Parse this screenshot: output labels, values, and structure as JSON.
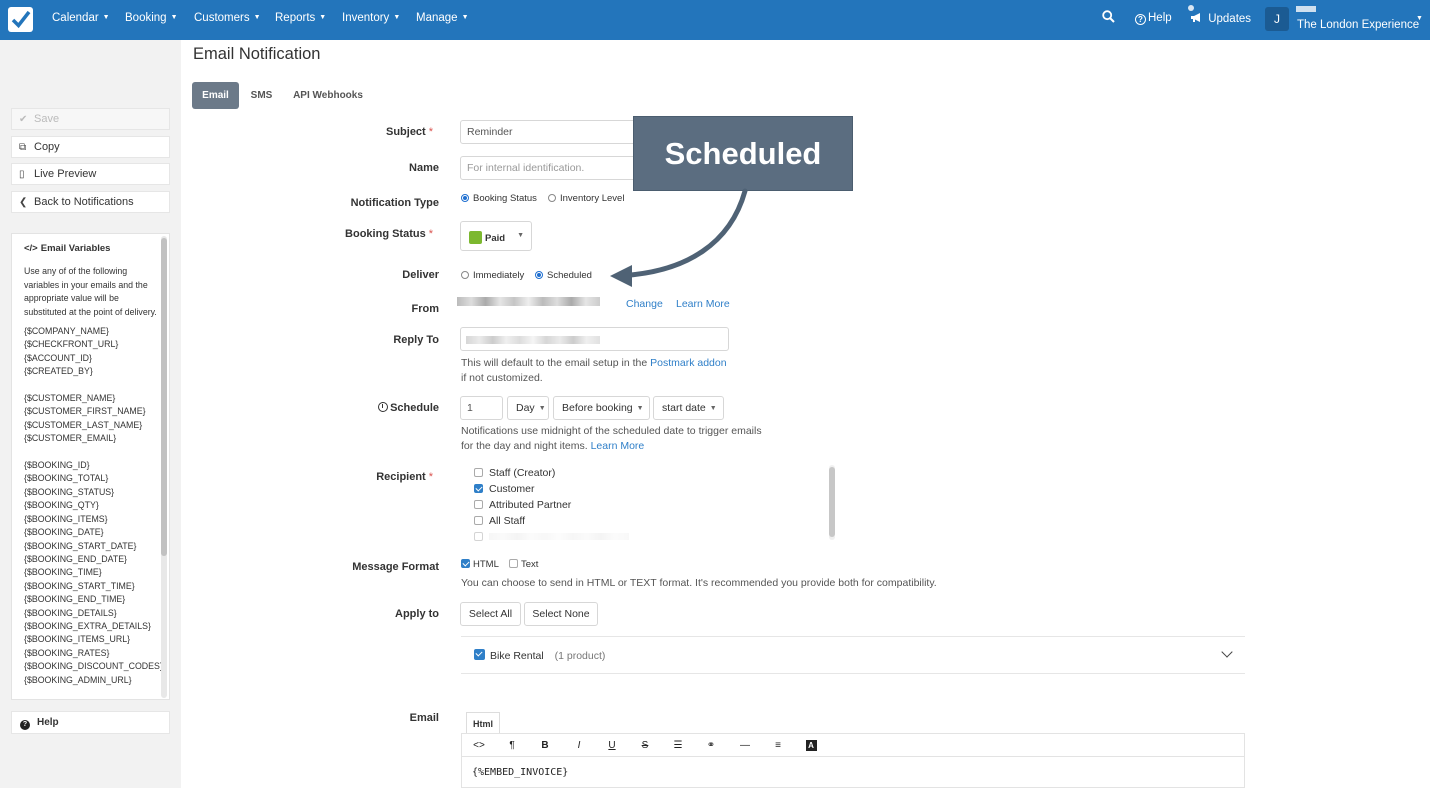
{
  "nav": {
    "items": [
      "Calendar",
      "Booking",
      "Customers",
      "Reports",
      "Inventory",
      "Manage"
    ],
    "help": "Help",
    "updates": "Updates",
    "avatar_letter": "J",
    "account": "The London Experience"
  },
  "sidebar": {
    "save": "Save",
    "copy": "Copy",
    "preview": "Live Preview",
    "back": "Back to Notifications",
    "help": "Help",
    "vars_title": "Email Variables",
    "vars_desc": "Use any of of the following variables in your emails and the appropriate value will be substituted at the point of delivery.",
    "group1": [
      "{$COMPANY_NAME}",
      "{$CHECKFRONT_URL}",
      "{$ACCOUNT_ID}",
      "{$CREATED_BY}"
    ],
    "group2": [
      "{$CUSTOMER_NAME}",
      "{$CUSTOMER_FIRST_NAME}",
      "{$CUSTOMER_LAST_NAME}",
      "{$CUSTOMER_EMAIL}"
    ],
    "group3": [
      "{$BOOKING_ID}",
      "{$BOOKING_TOTAL}",
      "{$BOOKING_STATUS}",
      "{$BOOKING_QTY}",
      "{$BOOKING_ITEMS}",
      "{$BOOKING_DATE}",
      "{$BOOKING_START_DATE}",
      "{$BOOKING_END_DATE}",
      "{$BOOKING_TIME}",
      "{$BOOKING_START_TIME}",
      "{$BOOKING_END_TIME}",
      "{$BOOKING_DETAILS}",
      "{$BOOKING_EXTRA_DETAILS}",
      "{$BOOKING_ITEMS_URL}",
      "{$BOOKING_RATES}",
      "{$BOOKING_DISCOUNT_CODES}",
      "{$BOOKING_ADMIN_URL}"
    ]
  },
  "page": {
    "title": "Email Notification",
    "tabs": [
      "Email",
      "SMS",
      "API Webhooks"
    ]
  },
  "form": {
    "subject_label": "Subject",
    "subject_value": "Reminder",
    "name_label": "Name",
    "name_placeholder": "For internal identification.",
    "type_label": "Notification Type",
    "type_options": [
      "Booking Status",
      "Inventory Level"
    ],
    "status_label": "Booking Status",
    "status_value": "Paid",
    "status_color": "#7cb82f",
    "deliver_label": "Deliver",
    "deliver_options": [
      "Immediately",
      "Scheduled"
    ],
    "from_label": "From",
    "from_change": "Change",
    "from_learn": "Learn More",
    "reply_label": "Reply To",
    "reply_hint_1": "This will default to the email setup in the",
    "reply_hint_link": "Postmark addon",
    "reply_hint_2": "if not customized.",
    "schedule_label": "Schedule",
    "schedule_qty": "1",
    "schedule_unit": "Day",
    "schedule_when": "Before booking",
    "schedule_ref": "start date",
    "schedule_hint_1": "Notifications use midnight of the scheduled date to trigger emails",
    "schedule_hint_2": "for the day and night items.",
    "schedule_hint_link": "Learn More",
    "recipient_label": "Recipient",
    "recipients": [
      "Staff (Creator)",
      "Customer",
      "Attributed Partner",
      "All Staff"
    ],
    "format_label": "Message Format",
    "format_options": [
      "HTML",
      "Text"
    ],
    "format_hint": "You can choose to send in HTML or TEXT format. It's recommended you provide both for compatibility.",
    "apply_label": "Apply to",
    "select_all": "Select All",
    "select_none": "Select None",
    "product_name": "Bike Rental",
    "product_count": "(1 product)",
    "email_label": "Email",
    "editor_tab": "Html",
    "editor_content": "{%EMBED_INVOICE}"
  },
  "annotation": {
    "text": "Scheduled"
  }
}
